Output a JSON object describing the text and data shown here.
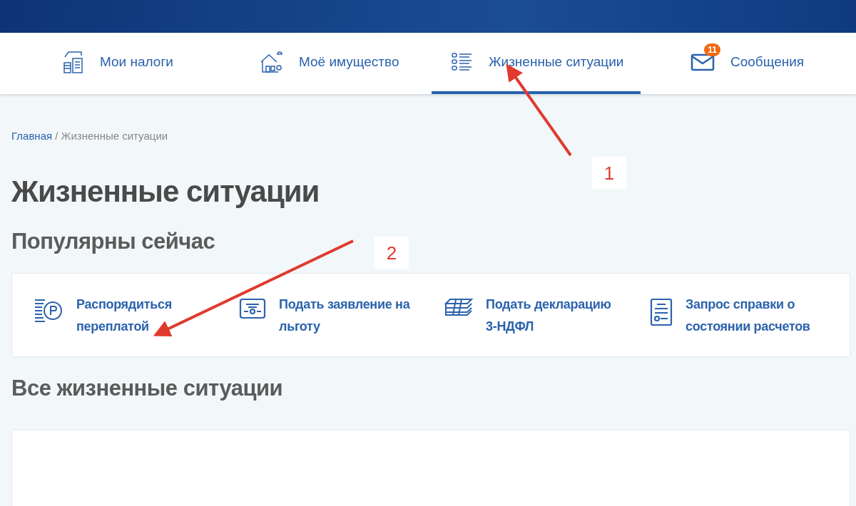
{
  "nav": {
    "tabs": [
      {
        "label": "Мои налоги",
        "selected": false
      },
      {
        "label": "Моё имущество",
        "selected": false
      },
      {
        "label": "Жизненные ситуации",
        "selected": true
      },
      {
        "label": "Сообщения",
        "selected": false,
        "badge": "11"
      }
    ]
  },
  "breadcrumb": {
    "link": "Главная",
    "separator": "/",
    "current": "Жизненные ситуации"
  },
  "title": "Жизненные ситуации",
  "popular": {
    "heading": "Популярны сейчас",
    "items": [
      {
        "label": "Распорядиться переплатой"
      },
      {
        "label": "Подать заявление на льготу"
      },
      {
        "label": "Подать декларацию 3-НДФЛ"
      },
      {
        "label": "Запрос справки о состоянии расчетов"
      }
    ]
  },
  "all": {
    "heading": "Все жизненные ситуации"
  },
  "annotations": [
    {
      "label": "1"
    },
    {
      "label": "2"
    }
  ]
}
